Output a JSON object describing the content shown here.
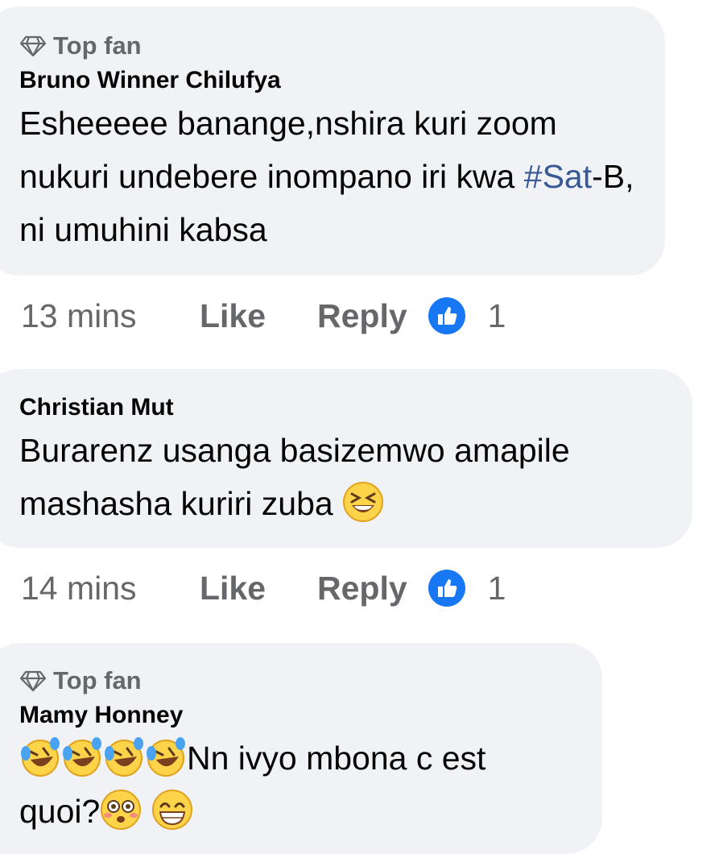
{
  "comments": [
    {
      "badge": "Top fan",
      "author": "Bruno Winner Chilufya",
      "text_part1": "Esheeeee banange,nshira kuri zoom nukuri undebere inompano iri kwa ",
      "hashtag": "#Sat",
      "text_part2": "-B, ni umuhini kabsa",
      "time": "13 mins",
      "like_label": "Like",
      "reply_label": "Reply",
      "reaction_count": "1"
    },
    {
      "author": "Christian Mut",
      "text": "Burarenz usanga basizemwo amapile mashasha kuriri zuba",
      "time": "14 mins",
      "like_label": "Like",
      "reply_label": "Reply",
      "reaction_count": "1"
    },
    {
      "badge": "Top fan",
      "author": "Mamy Honney",
      "text_part1": "Nn ivyo mbona c est",
      "text_part2": "quoi?"
    }
  ],
  "icons": {
    "badge": "diamond-icon",
    "reaction": "thumbs-up-icon",
    "emoji_laugh": "grinning-squinting-face-icon",
    "emoji_rofl": "rolling-on-floor-laughing-icon",
    "emoji_flushed": "flushed-face-icon",
    "emoji_grin": "beaming-face-icon"
  },
  "colors": {
    "bubble": "#f0f2f5",
    "hashtag": "#385898",
    "like_blue": "#1877f2",
    "secondary_text": "#65676b"
  }
}
